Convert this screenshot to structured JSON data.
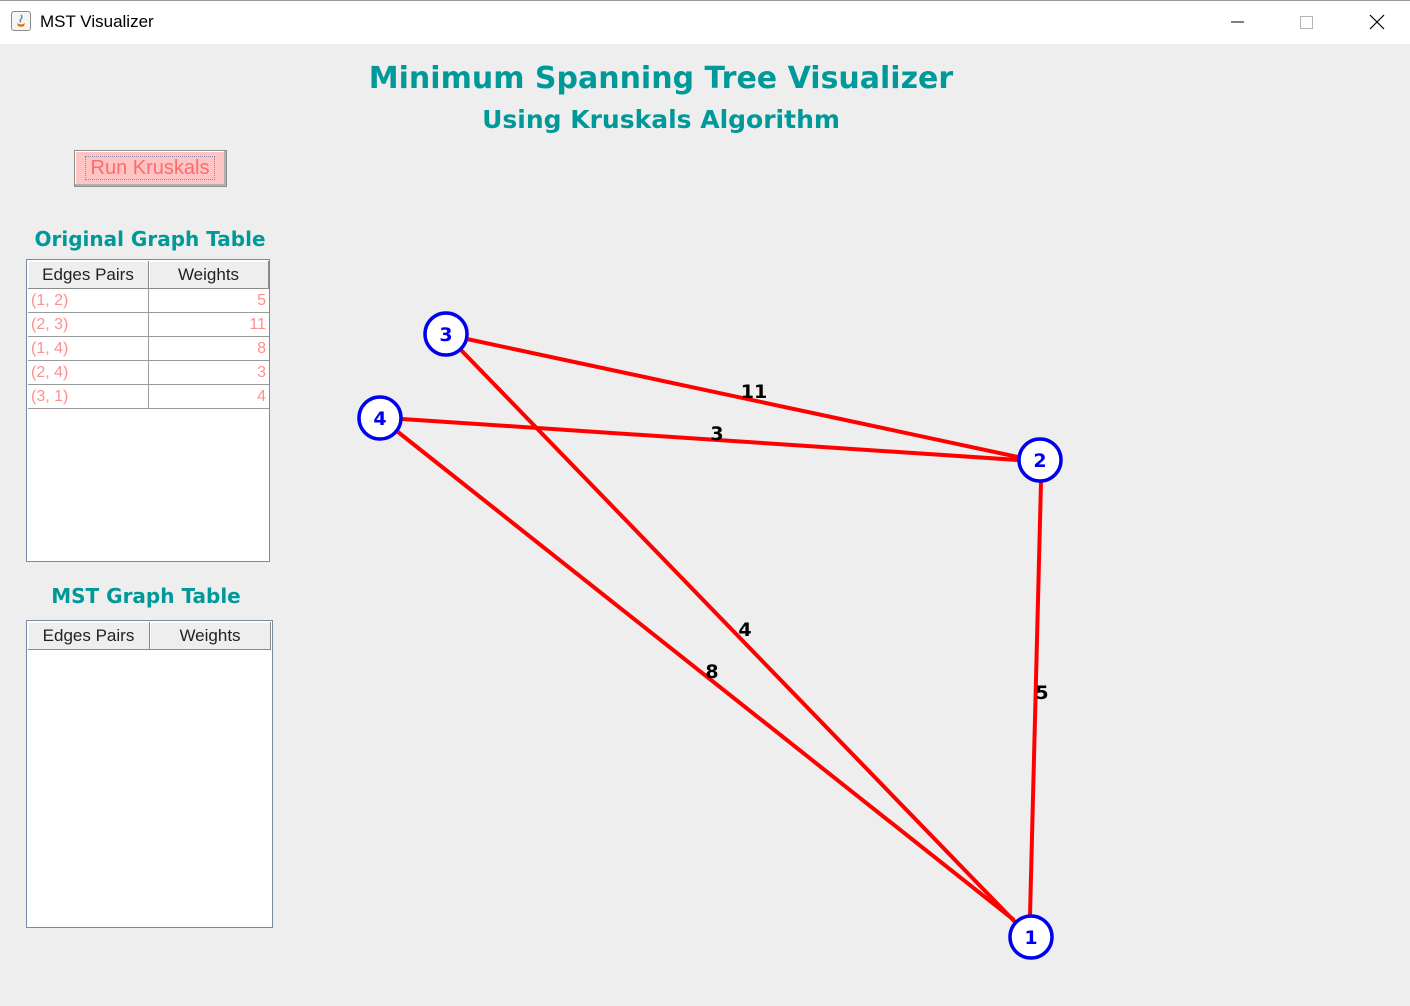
{
  "window": {
    "title": "MST Visualizer"
  },
  "header": {
    "title": "Minimum Spanning Tree Visualizer",
    "subtitle": "Using Kruskals Algorithm"
  },
  "controls": {
    "run_button_label": "Run Kruskals"
  },
  "original_table": {
    "title": "Original Graph Table",
    "columns": [
      "Edges Pairs",
      "Weights"
    ],
    "rows": [
      {
        "pair": "(1, 2)",
        "weight": "5"
      },
      {
        "pair": "(2, 3)",
        "weight": "11"
      },
      {
        "pair": "(1, 4)",
        "weight": "8"
      },
      {
        "pair": "(2, 4)",
        "weight": "3"
      },
      {
        "pair": "(3, 1)",
        "weight": "4"
      }
    ]
  },
  "mst_table": {
    "title": "MST Graph Table",
    "columns": [
      "Edges Pairs",
      "Weights"
    ],
    "rows": []
  },
  "graph": {
    "nodes": [
      "1",
      "2",
      "3",
      "4"
    ],
    "edges": [
      {
        "from": "1",
        "to": "2",
        "weight": "5"
      },
      {
        "from": "2",
        "to": "3",
        "weight": "11"
      },
      {
        "from": "1",
        "to": "4",
        "weight": "8"
      },
      {
        "from": "2",
        "to": "4",
        "weight": "3"
      },
      {
        "from": "3",
        "to": "1",
        "weight": "4"
      }
    ],
    "colors": {
      "edge": "#ff0000",
      "node": "#0000ee",
      "weight_label": "#000000"
    }
  },
  "colors": {
    "accent": "#009999",
    "row_text": "#ff8f8f",
    "button_bg": "#ffc4c4",
    "button_text": "#ff6b6b"
  }
}
